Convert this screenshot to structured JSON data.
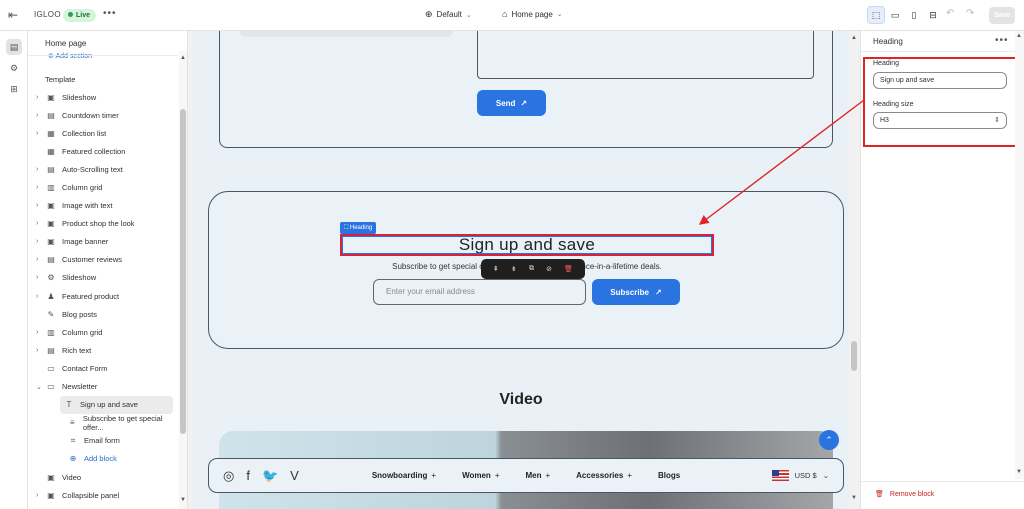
{
  "topbar": {
    "store_name": "IGLOO",
    "status": "Live",
    "more": "•••",
    "theme": "Default",
    "page": "Home page",
    "save": "Save"
  },
  "left_panel": {
    "title": "Home page",
    "add_section_top": "Add section",
    "template_label": "Template",
    "items": [
      {
        "label": "Slideshow",
        "icon": "slideshow-icon",
        "glyph": "▣",
        "caret": true
      },
      {
        "label": "Countdown timer",
        "icon": "timer-icon",
        "glyph": "▤",
        "caret": true
      },
      {
        "label": "Collection list",
        "icon": "collection-icon",
        "glyph": "▦",
        "caret": true
      },
      {
        "label": "Featured collection",
        "icon": "collection-icon",
        "glyph": "▦",
        "caret": false
      },
      {
        "label": "Auto-Scrolling text",
        "icon": "text-icon",
        "glyph": "▤",
        "caret": true
      },
      {
        "label": "Column grid",
        "icon": "columns-icon",
        "glyph": "▥",
        "caret": true
      },
      {
        "label": "Image with text",
        "icon": "image-icon",
        "glyph": "▣",
        "caret": true
      },
      {
        "label": "Product shop the look",
        "icon": "product-icon",
        "glyph": "▣",
        "caret": true
      },
      {
        "label": "Image banner",
        "icon": "image-icon",
        "glyph": "▣",
        "caret": true
      },
      {
        "label": "Customer reviews",
        "icon": "reviews-icon",
        "glyph": "▤",
        "caret": true
      },
      {
        "label": "Slideshow",
        "icon": "slideshow-icon",
        "glyph": "⚙",
        "caret": true
      },
      {
        "label": "Featured product",
        "icon": "product-icon",
        "glyph": "♟",
        "caret": true
      },
      {
        "label": "Blog posts",
        "icon": "blog-icon",
        "glyph": "✎",
        "caret": false
      },
      {
        "label": "Column grid",
        "icon": "columns-icon",
        "glyph": "▥",
        "caret": true
      },
      {
        "label": "Rich text",
        "icon": "richtext-icon",
        "glyph": "▤",
        "caret": true
      },
      {
        "label": "Contact Form",
        "icon": "form-icon",
        "glyph": "▭",
        "caret": false
      },
      {
        "label": "Newsletter",
        "icon": "newsletter-icon",
        "glyph": "▭",
        "caret": true,
        "expanded": true
      }
    ],
    "newsletter_children": [
      {
        "label": "Sign up and save",
        "icon": "heading-icon",
        "glyph": "T",
        "selected": true
      },
      {
        "label": "Subscribe to get special offer...",
        "icon": "paragraph-icon",
        "glyph": "≡"
      },
      {
        "label": "Email form",
        "icon": "email-form-icon",
        "glyph": "⌗"
      },
      {
        "label": "Add block",
        "icon": "add-icon",
        "glyph": "⊕",
        "link": true
      }
    ],
    "items_after": [
      {
        "label": "Video",
        "icon": "video-icon",
        "glyph": "▣",
        "caret": false
      },
      {
        "label": "Collapsible panel",
        "icon": "collapsible-icon",
        "glyph": "▣",
        "caret": true
      }
    ]
  },
  "preview": {
    "send_label": "Send",
    "heading_tag": "Heading",
    "heading": "Sign up and save",
    "subtext": "Subscribe to get special offers, free giveaways, and once-in-a-lifetime deals.",
    "email_placeholder": "Enter your email address",
    "subscribe_label": "Subscribe",
    "video_title": "Video",
    "nav": [
      "Snowboarding",
      "Women",
      "Men",
      "Accessories",
      "Blogs"
    ],
    "nav_has_plus": [
      true,
      true,
      true,
      true,
      false
    ],
    "currency": "USD $"
  },
  "right_panel": {
    "title": "Heading",
    "heading_label": "Heading",
    "heading_value": "Sign up and save",
    "size_label": "Heading size",
    "size_value": "H3",
    "remove_block": "Remove block"
  },
  "colors": {
    "accent": "#2a74e2",
    "annotation_red": "#e02424",
    "live_green": "#2e9b57"
  }
}
